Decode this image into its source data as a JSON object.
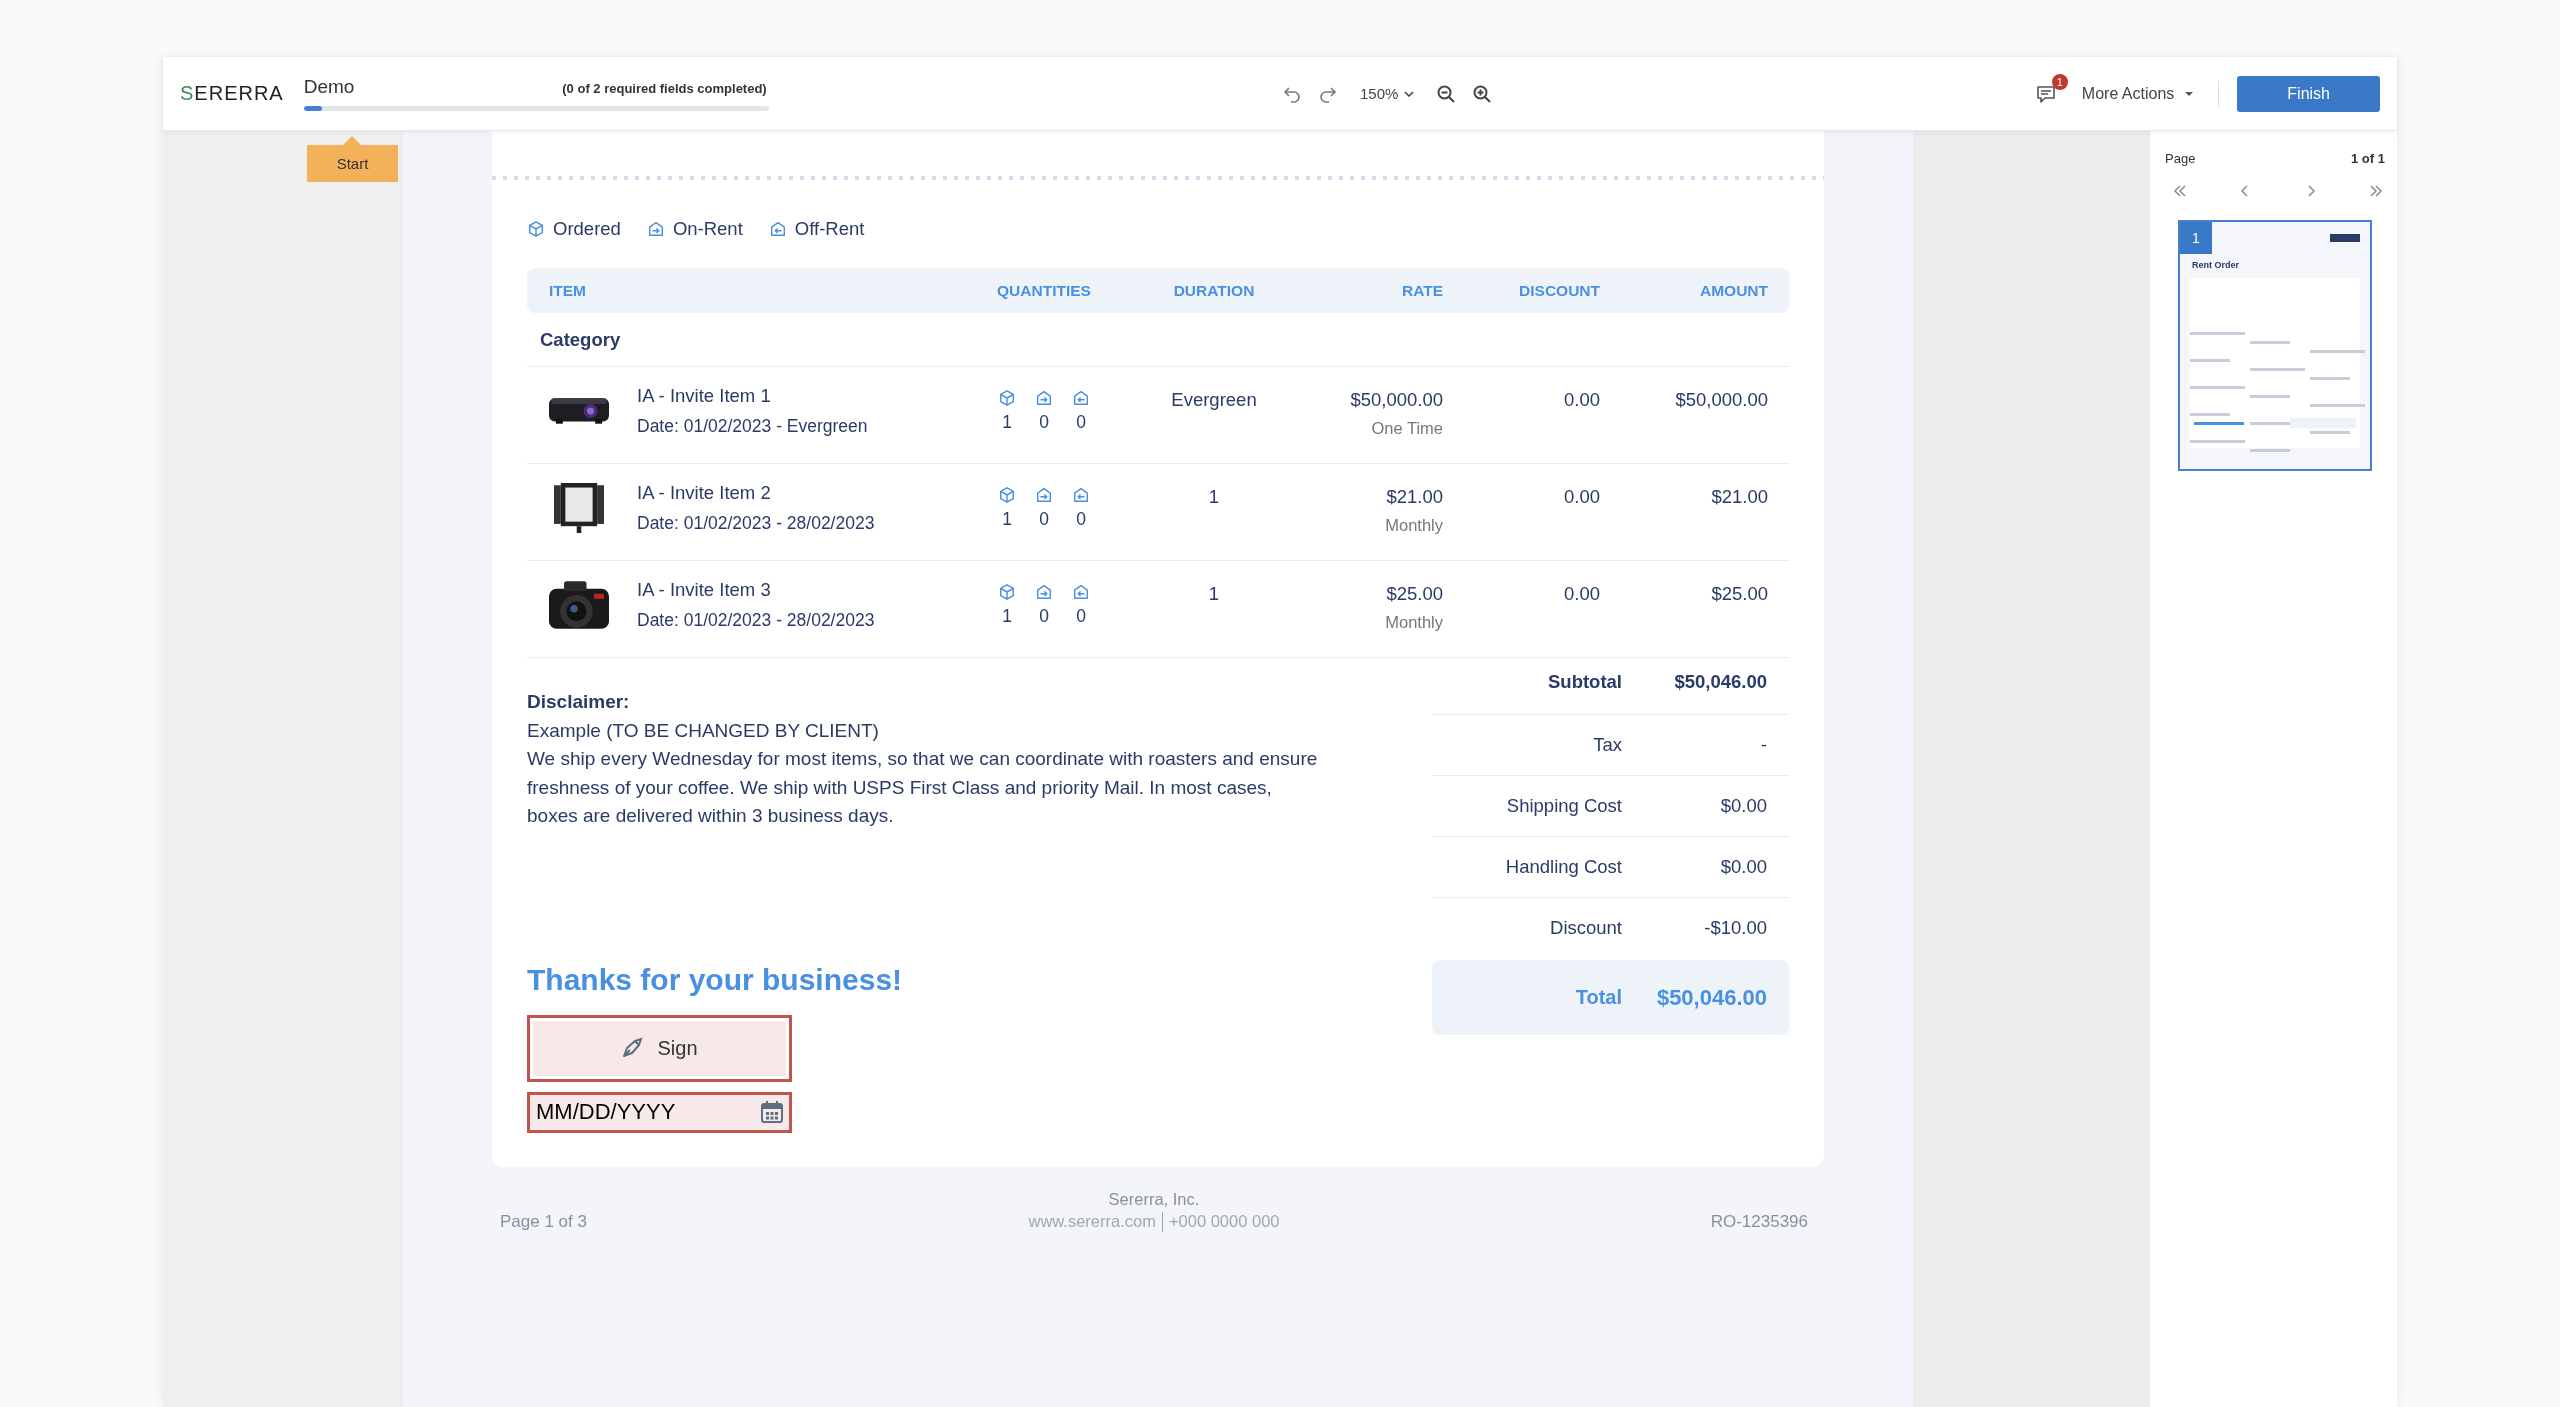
{
  "header": {
    "logo": "SERERRA",
    "document_title": "Demo",
    "progress_text": "(0 of 2 required fields completed)",
    "progress": {
      "level": 0.04
    },
    "zoom": "150%",
    "notification_count": "1",
    "more_actions": "More Actions",
    "finish": "Finish"
  },
  "start_tag": "Start",
  "legend": [
    {
      "kind": "ordered",
      "label": "Ordered"
    },
    {
      "kind": "on_rent",
      "label": "On-Rent"
    },
    {
      "kind": "off_rent",
      "label": "Off-Rent"
    }
  ],
  "table": {
    "columns": [
      "ITEM",
      "QUANTITIES",
      "DURATION",
      "RATE",
      "DISCOUNT",
      "AMOUNT"
    ],
    "category": "Category",
    "rows": [
      {
        "name": "IA - Invite Item 1",
        "date": "Date: 01/02/2023 - Evergreen",
        "quantities": [
          "1",
          "0",
          "0"
        ],
        "duration": "Evergreen",
        "rate": "$50,000.00",
        "rate_period": "One Time",
        "discount": "0.00",
        "amount": "$50,000.00"
      },
      {
        "name": "IA - Invite Item 2",
        "date": "Date: 01/02/2023 - 28/02/2023",
        "quantities": [
          "1",
          "0",
          "0"
        ],
        "duration": "1",
        "rate": "$21.00",
        "rate_period": "Monthly",
        "discount": "0.00",
        "amount": "$21.00"
      },
      {
        "name": "IA - Invite Item 3",
        "date": "Date: 01/02/2023 - 28/02/2023",
        "quantities": [
          "1",
          "0",
          "0"
        ],
        "duration": "1",
        "rate": "$25.00",
        "rate_period": "Monthly",
        "discount": "0.00",
        "amount": "$25.00"
      }
    ]
  },
  "disclaimer": {
    "title": "Disclaimer:",
    "lines": [
      "Example (TO BE CHANGED BY CLIENT)",
      "We ship every Wednesday for most items, so that we can coordinate with roasters and ensure freshness of your coffee. We ship with USPS First Class and priority Mail. In most cases, boxes are delivered within 3 business days."
    ]
  },
  "totals": [
    {
      "kind": "subtotal",
      "label": "Subtotal",
      "value": "$50,046.00"
    },
    {
      "kind": "line",
      "label": "Tax",
      "value": "-"
    },
    {
      "kind": "line",
      "label": "Shipping Cost",
      "value": "$0.00"
    },
    {
      "kind": "line",
      "label": "Handling Cost",
      "value": "$0.00"
    },
    {
      "kind": "line",
      "label": "Discount",
      "value": "-$10.00"
    },
    {
      "kind": "total",
      "label": "Total",
      "value": "$50,046.00"
    }
  ],
  "thanks": "Thanks for your business!",
  "sign_button": "Sign",
  "date_field": {
    "placeholder": "MM/DD/YYYY"
  },
  "footer": {
    "page": "Page 1 of 3",
    "company": "Sererra, Inc.",
    "website": "www.sererra.com",
    "phone": "+000 0000 000",
    "order_number": "RO-1235396"
  },
  "pager": {
    "label": "Page",
    "count": "1 of 1"
  },
  "thumbnail": {
    "number": "1",
    "title": "Rent Order",
    "selected": true
  }
}
